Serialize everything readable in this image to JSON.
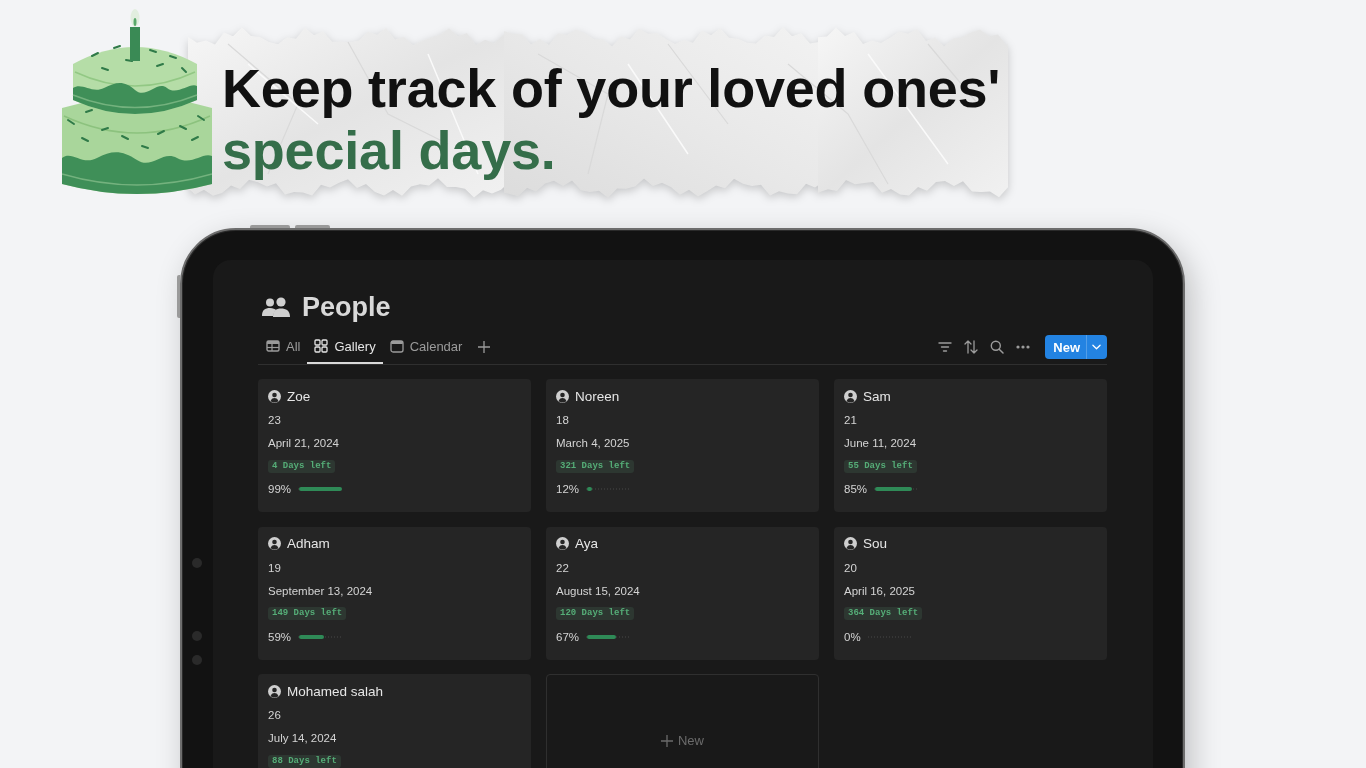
{
  "header": {
    "headline": "Keep track of your loved ones'",
    "headline_highlight": "special days."
  },
  "page": {
    "title": "People"
  },
  "views": [
    {
      "label": "All",
      "kind": "table",
      "selected": false
    },
    {
      "label": "Gallery",
      "kind": "gallery",
      "selected": true
    },
    {
      "label": "Calendar",
      "kind": "calendar",
      "selected": false
    }
  ],
  "toolbar": {
    "new_button": "New"
  },
  "cards": [
    {
      "name": "Zoe",
      "age": "23",
      "date": "April 21, 2024",
      "days_left": "4 Days left",
      "percent": "99%",
      "level": 0.99
    },
    {
      "name": "Noreen",
      "age": "18",
      "date": "March 4, 2025",
      "days_left": "321 Days left",
      "percent": "12%",
      "level": 0.12
    },
    {
      "name": "Sam",
      "age": "21",
      "date": "June 11, 2024",
      "days_left": "55 Days left",
      "percent": "85%",
      "level": 0.85
    },
    {
      "name": "Adham",
      "age": "19",
      "date": "September 13, 2024",
      "days_left": "149 Days left",
      "percent": "59%",
      "level": 0.59
    },
    {
      "name": "Aya",
      "age": "22",
      "date": "August 15, 2024",
      "days_left": "120 Days left",
      "percent": "67%",
      "level": 0.67
    },
    {
      "name": "Sou",
      "age": "20",
      "date": "April 16, 2025",
      "days_left": "364 Days left",
      "percent": "0%",
      "level": 0
    },
    {
      "name": "Mohamed salah",
      "age": "26",
      "date": "July 14, 2024",
      "days_left": "88 Days left"
    }
  ],
  "new_card": {
    "label": "New"
  }
}
